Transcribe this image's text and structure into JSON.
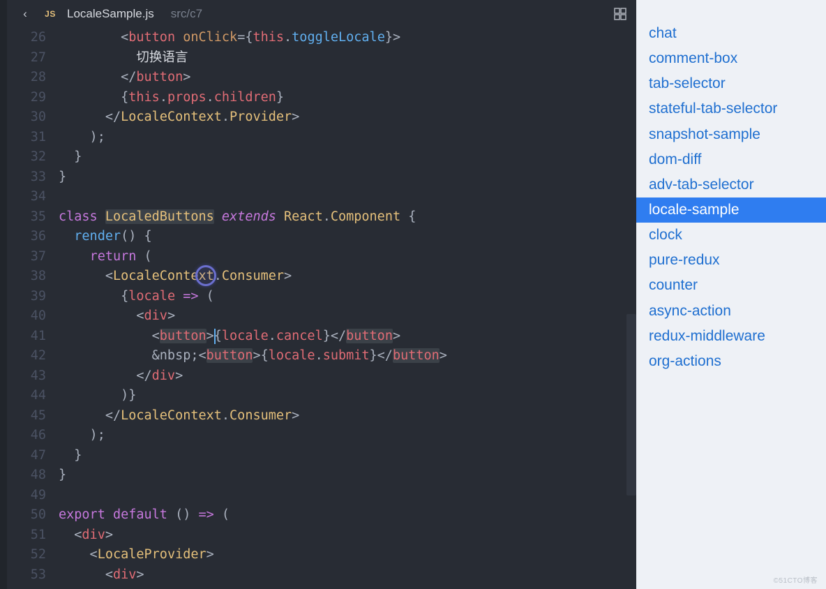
{
  "tab": {
    "lang_badge": "JS",
    "filename": "LocaleSample.js",
    "breadcrumb": "src/c7"
  },
  "gutter": {
    "start": 26,
    "end": 53
  },
  "code": {
    "lines": [
      [
        [
          "        <",
          "punc"
        ],
        [
          "button",
          "tag"
        ],
        [
          " ",
          "punc"
        ],
        [
          "onClick",
          "attr"
        ],
        [
          "={",
          "punc"
        ],
        [
          "this",
          "id"
        ],
        [
          ".",
          "punc"
        ],
        [
          "toggleLocale",
          "fn"
        ],
        [
          "}>",
          "punc"
        ]
      ],
      [
        [
          "          ",
          "punc"
        ],
        [
          "切换语言",
          "text"
        ]
      ],
      [
        [
          "        </",
          "punc"
        ],
        [
          "button",
          "tag"
        ],
        [
          ">",
          "punc"
        ]
      ],
      [
        [
          "        {",
          "punc"
        ],
        [
          "this",
          "id"
        ],
        [
          ".",
          "punc"
        ],
        [
          "props",
          "id"
        ],
        [
          ".",
          "punc"
        ],
        [
          "children",
          "id"
        ],
        [
          "}",
          "punc"
        ]
      ],
      [
        [
          "      </",
          "punc"
        ],
        [
          "LocaleContext",
          "comp"
        ],
        [
          ".",
          "punc"
        ],
        [
          "Provider",
          "comp"
        ],
        [
          ">",
          "punc"
        ]
      ],
      [
        [
          "    );",
          "punc"
        ]
      ],
      [
        [
          "  }",
          "punc"
        ]
      ],
      [
        [
          "}",
          "punc"
        ]
      ],
      [
        [
          "",
          "punc"
        ]
      ],
      [
        [
          "class ",
          "kw"
        ],
        [
          "LocaledButtons",
          "comp",
          true
        ],
        [
          " ",
          "punc"
        ],
        [
          "extends",
          "kw2"
        ],
        [
          " ",
          "punc"
        ],
        [
          "React",
          "comp"
        ],
        [
          ".",
          "punc"
        ],
        [
          "Component",
          "comp"
        ],
        [
          " {",
          "punc"
        ]
      ],
      [
        [
          "  ",
          "punc"
        ],
        [
          "render",
          "fn"
        ],
        [
          "() {",
          "punc"
        ]
      ],
      [
        [
          "    ",
          "punc"
        ],
        [
          "return",
          "kw"
        ],
        [
          " (",
          "punc"
        ]
      ],
      [
        [
          "      <",
          "punc"
        ],
        [
          "LocaleContext",
          "comp"
        ],
        [
          ".",
          "punc"
        ],
        [
          "Consumer",
          "comp"
        ],
        [
          ">",
          "punc"
        ]
      ],
      [
        [
          "        {",
          "punc"
        ],
        [
          "locale",
          "id"
        ],
        [
          " ",
          "punc"
        ],
        [
          "=>",
          "kw"
        ],
        [
          " (",
          "punc"
        ]
      ],
      [
        [
          "          <",
          "punc"
        ],
        [
          "div",
          "tag"
        ],
        [
          ">",
          "punc"
        ]
      ],
      [
        [
          "            <",
          "punc"
        ],
        [
          "button",
          "tag",
          true
        ],
        [
          ">{",
          "punc"
        ],
        [
          "locale",
          "id"
        ],
        [
          ".",
          "punc"
        ],
        [
          "cancel",
          "id"
        ],
        [
          "}</",
          "punc"
        ],
        [
          "button",
          "tag",
          true
        ],
        [
          ">",
          "punc"
        ]
      ],
      [
        [
          "            &nbsp;<",
          "punc"
        ],
        [
          "button",
          "tag",
          true
        ],
        [
          ">{",
          "punc"
        ],
        [
          "locale",
          "id"
        ],
        [
          ".",
          "punc"
        ],
        [
          "submit",
          "id"
        ],
        [
          "}</",
          "punc"
        ],
        [
          "button",
          "tag",
          true
        ],
        [
          ">",
          "punc"
        ]
      ],
      [
        [
          "          </",
          "punc"
        ],
        [
          "div",
          "tag"
        ],
        [
          ">",
          "punc"
        ]
      ],
      [
        [
          "        )}",
          "punc"
        ]
      ],
      [
        [
          "      </",
          "punc"
        ],
        [
          "LocaleContext",
          "comp"
        ],
        [
          ".",
          "punc"
        ],
        [
          "Consumer",
          "comp"
        ],
        [
          ">",
          "punc"
        ]
      ],
      [
        [
          "    );",
          "punc"
        ]
      ],
      [
        [
          "  }",
          "punc"
        ]
      ],
      [
        [
          "}",
          "punc"
        ]
      ],
      [
        [
          "",
          "punc"
        ]
      ],
      [
        [
          "export ",
          "kw"
        ],
        [
          "default ",
          "kw"
        ],
        [
          "() ",
          "punc"
        ],
        [
          "=>",
          "kw"
        ],
        [
          " (",
          "punc"
        ]
      ],
      [
        [
          "  <",
          "punc"
        ],
        [
          "div",
          "tag"
        ],
        [
          ">",
          "punc"
        ]
      ],
      [
        [
          "    <",
          "punc"
        ],
        [
          "LocaleProvider",
          "comp"
        ],
        [
          ">",
          "punc"
        ]
      ],
      [
        [
          "      <",
          "punc"
        ],
        [
          "div",
          "tag"
        ],
        [
          ">",
          "punc"
        ]
      ]
    ]
  },
  "caret_line_index": 15,
  "caret_char": 20,
  "cursor_ring": {
    "line_index": 12,
    "char": 12
  },
  "routes": [
    "chat",
    "comment-box",
    "tab-selector",
    "stateful-tab-selector",
    "snapshot-sample",
    "dom-diff",
    "adv-tab-selector",
    "locale-sample",
    "clock",
    "pure-redux",
    "counter",
    "async-action",
    "redux-middleware",
    "org-actions"
  ],
  "active_route": "locale-sample",
  "watermark": "©51CTO博客"
}
